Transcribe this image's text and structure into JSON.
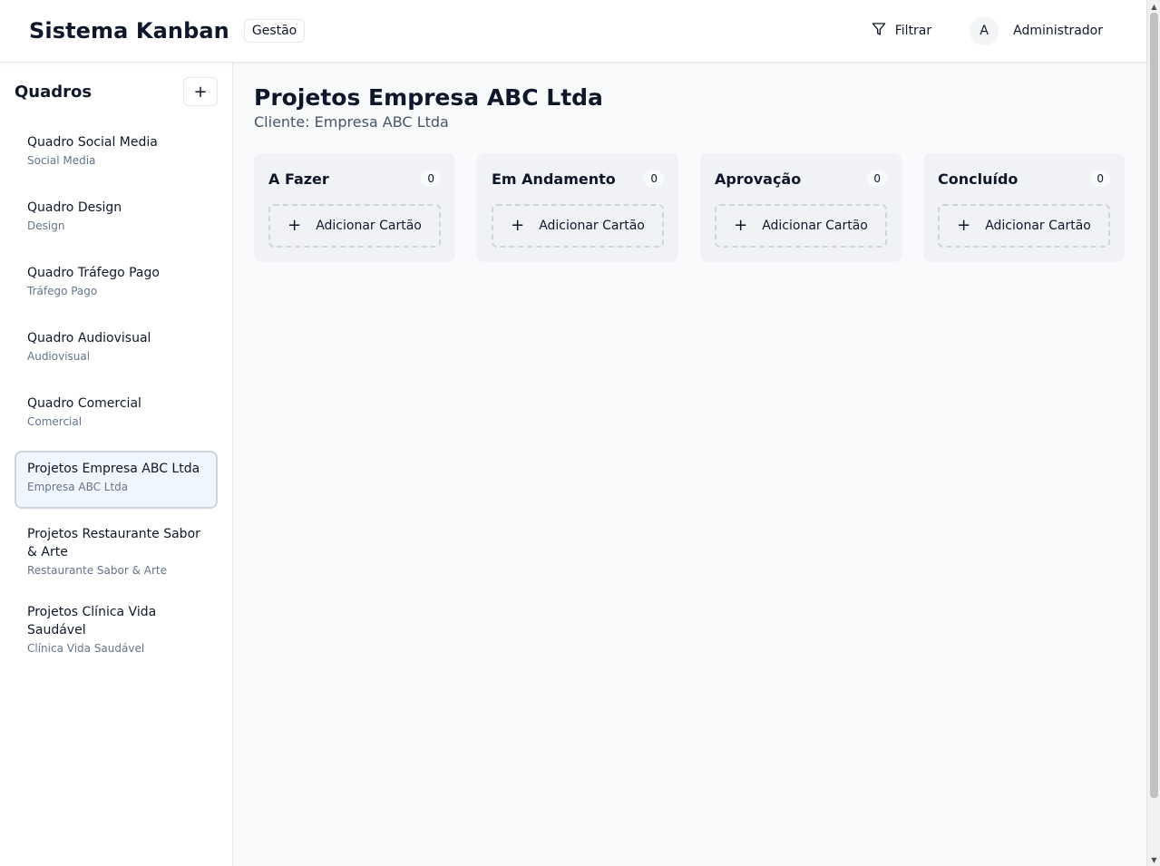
{
  "header": {
    "title": "Sistema Kanban",
    "badge": "Gestão",
    "filter_label": "Filtrar",
    "user_initial": "A",
    "user_name": "Administrador"
  },
  "sidebar": {
    "title": "Quadros",
    "add_label": "+",
    "items": [
      {
        "name": "Quadro Social Media",
        "sub": "Social Media"
      },
      {
        "name": "Quadro Design",
        "sub": "Design"
      },
      {
        "name": "Quadro Tráfego Pago",
        "sub": "Tráfego Pago"
      },
      {
        "name": "Quadro Audiovisual",
        "sub": "Audiovisual"
      },
      {
        "name": "Quadro Comercial",
        "sub": "Comercial"
      },
      {
        "name": "Projetos Empresa ABC Ltda",
        "sub": "Empresa ABC Ltda"
      },
      {
        "name": "Projetos Restaurante Sabor & Arte",
        "sub": "Restaurante Sabor & Arte"
      },
      {
        "name": "Projetos Clínica Vida Saudável",
        "sub": "Clínica Vida Saudável"
      }
    ],
    "active_index": 5
  },
  "main": {
    "title": "Projetos Empresa ABC Ltda",
    "subtitle": "Cliente: Empresa ABC Ltda",
    "add_card_label": "Adicionar Cartão",
    "add_card_icon": "+",
    "columns": [
      {
        "title": "A Fazer",
        "count": "0"
      },
      {
        "title": "Em Andamento",
        "count": "0"
      },
      {
        "title": "Aprovação",
        "count": "0"
      },
      {
        "title": "Concluído",
        "count": "0"
      }
    ]
  },
  "icons": {
    "filter": "filter-icon",
    "plus": "plus-icon"
  },
  "colors": {
    "active_board_bg": "#eff6ff",
    "column_bg": "#f1f2f5",
    "main_bg": "#f8fafc"
  }
}
